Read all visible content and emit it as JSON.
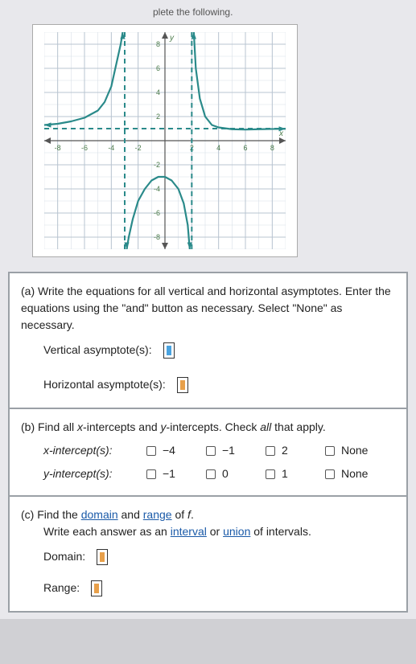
{
  "header_fragment": "plete the following.",
  "chart_data": {
    "type": "line",
    "title": "",
    "xlabel": "x",
    "ylabel": "y",
    "xlim": [
      -9,
      9
    ],
    "ylim": [
      -9,
      9
    ],
    "xticks": [
      -8,
      -6,
      -4,
      -2,
      2,
      4,
      6,
      8
    ],
    "yticks": [
      -8,
      -6,
      -4,
      -2,
      2,
      4,
      6,
      8
    ],
    "vertical_asymptotes": [
      -3,
      2
    ],
    "horizontal_asymptotes": [
      1
    ],
    "series": [
      {
        "name": "left-branch",
        "x": [
          -9,
          -8,
          -7,
          -6,
          -5,
          -4.5,
          -4,
          -3.6,
          -3.3,
          -3.15
        ],
        "y": [
          1.3,
          1.4,
          1.6,
          1.9,
          2.5,
          3.2,
          4.5,
          6.5,
          8.0,
          9.0
        ]
      },
      {
        "name": "middle-branch",
        "x": [
          -2.85,
          -2.7,
          -2.4,
          -2,
          -1.5,
          -1,
          -0.5,
          0,
          0.5,
          1,
          1.4,
          1.7,
          1.85
        ],
        "y": [
          -9,
          -8,
          -6.5,
          -5,
          -4,
          -3.3,
          -3,
          -3,
          -3.3,
          -4,
          -5.2,
          -7,
          -9
        ]
      },
      {
        "name": "right-branch",
        "x": [
          2.15,
          2.3,
          2.6,
          3,
          3.5,
          4,
          5,
          6,
          7,
          8,
          9
        ],
        "y": [
          9,
          6,
          3.5,
          2,
          1.3,
          1.1,
          0.95,
          0.92,
          0.95,
          0.97,
          0.98
        ]
      }
    ]
  },
  "partA": {
    "label": "(a)",
    "text1": "Write the equations for all vertical and horizontal asymptotes. Enter the equations using the \"and\" button as necessary. Select \"None\" as necessary.",
    "vert_label": "Vertical asymptote(s):",
    "horiz_label": "Horizontal asymptote(s):"
  },
  "partB": {
    "label": "(b)",
    "text1_pre": "Find all ",
    "text1_x": "x",
    "text1_mid": "-intercepts and ",
    "text1_y": "y",
    "text1_post": "-intercepts. Check ",
    "text1_all": "all",
    "text1_end": " that apply.",
    "xrow_label": "x-intercept(s):",
    "yrow_label": "y-intercept(s):",
    "x_opts": [
      "−4",
      "−1",
      "2",
      "None"
    ],
    "y_opts": [
      "−1",
      "0",
      "1",
      "None"
    ]
  },
  "partC": {
    "label": "(c)",
    "text_pre": "Find the ",
    "domain_word": "domain",
    "text_and": " and ",
    "range_word": "range",
    "text_of": " of ",
    "fn": "f",
    "text_period": ".",
    "line2_pre": "Write each answer as an ",
    "interval_word": "interval",
    "line2_or": " or ",
    "union_word": "union",
    "line2_end": " of intervals.",
    "domain_label": "Domain:",
    "range_label": "Range:"
  }
}
